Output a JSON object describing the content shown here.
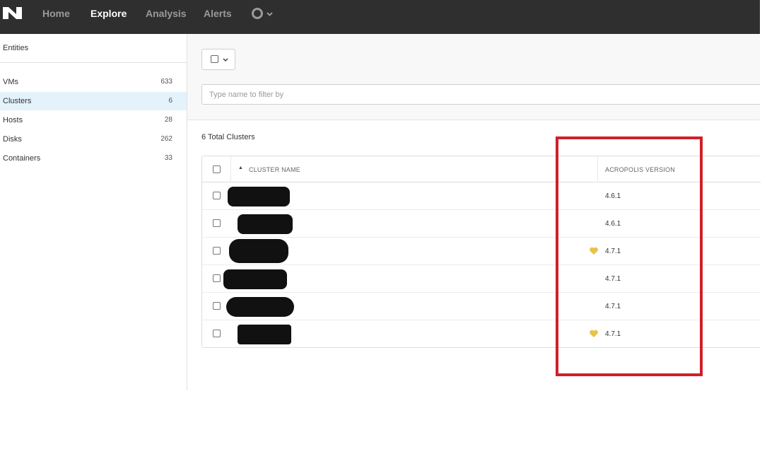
{
  "topbar": {
    "logo_icon": "nutanix-logo-icon",
    "nav": [
      {
        "label": "Home",
        "active": false
      },
      {
        "label": "Explore",
        "active": true
      },
      {
        "label": "Analysis",
        "active": false
      },
      {
        "label": "Alerts",
        "active": false
      }
    ],
    "status_icon": "circle-status-icon",
    "menu_icon": "chevron-down-icon"
  },
  "sidebar": {
    "heading": "Entities",
    "items": [
      {
        "label": "VMs",
        "count": "633",
        "active": false
      },
      {
        "label": "Clusters",
        "count": "6",
        "active": true
      },
      {
        "label": "Hosts",
        "count": "28",
        "active": false
      },
      {
        "label": "Disks",
        "count": "262",
        "active": false
      },
      {
        "label": "Containers",
        "count": "33",
        "active": false
      }
    ]
  },
  "toolbar": {
    "select_chevron": "⌄",
    "filter_placeholder": "Type name to filter by"
  },
  "summary": "6 Total Clusters",
  "table": {
    "columns": [
      "CLUSTER NAME",
      "ACROPOLIS VERSION"
    ],
    "sort_indicator": "▲",
    "rows": [
      {
        "version": "4.6.1",
        "heart": false
      },
      {
        "version": "4.6.1",
        "heart": false
      },
      {
        "version": "4.7.1",
        "heart": true
      },
      {
        "version": "4.7.1",
        "heart": false
      },
      {
        "version": "4.7.1",
        "heart": false
      },
      {
        "version": "4.7.1",
        "heart": true
      }
    ]
  },
  "colors": {
    "topbar_bg": "#2f2f2f",
    "active_row_bg": "#e3f2fb",
    "highlight_border": "#d0202a",
    "heart": "#e8c347"
  }
}
